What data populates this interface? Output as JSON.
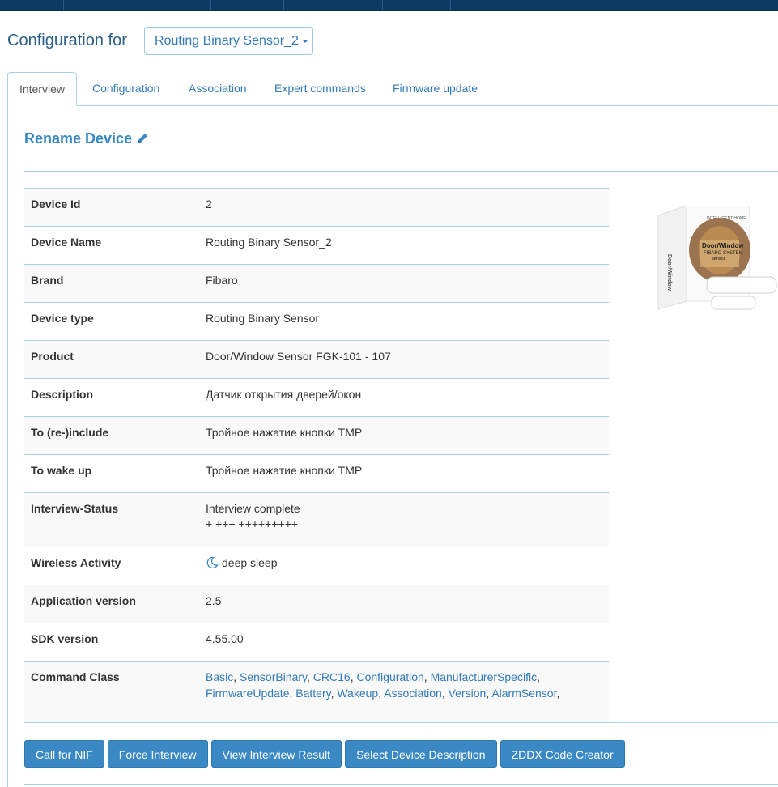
{
  "header": {
    "title": "Configuration for",
    "device_selected": "Routing Binary Sensor_2"
  },
  "tabs": [
    {
      "label": "Interview"
    },
    {
      "label": "Configuration"
    },
    {
      "label": "Association"
    },
    {
      "label": "Expert commands"
    },
    {
      "label": "Firmware update"
    }
  ],
  "rename_label": "Rename Device",
  "rows": [
    {
      "key": "Device Id",
      "value": "2"
    },
    {
      "key": "Device Name",
      "value": "Routing Binary Sensor_2"
    },
    {
      "key": "Brand",
      "value": "Fibaro"
    },
    {
      "key": "Device type",
      "value": "Routing Binary Sensor"
    },
    {
      "key": "Product",
      "value": "Door/Window Sensor FGK-101 - 107"
    },
    {
      "key": "Description",
      "value": "Датчик открытия дверей/окон"
    },
    {
      "key": "To (re-)include",
      "value": "Тройное нажатие кнопки TMP"
    },
    {
      "key": "To wake up",
      "value": "Тройное нажатие кнопки TMP"
    },
    {
      "key": "Interview-Status",
      "value": "Interview complete",
      "value2": "+ +++ +++++++++"
    },
    {
      "key": "Wireless Activity",
      "value": "deep sleep"
    },
    {
      "key": "Application version",
      "value": "2.5"
    },
    {
      "key": "SDK version",
      "value": "4.55.00"
    },
    {
      "key": "Command Class",
      "links_line1": [
        "Basic",
        "SensorBinary",
        "CRC16",
        "Configuration",
        "ManufacturerSpecific"
      ],
      "links_line2": [
        "FirmwareUpdate",
        "Battery",
        "Wakeup",
        "Association",
        "Version",
        "AlarmSensor"
      ]
    }
  ],
  "product_box": {
    "line1": "INTELLIGENT HOME",
    "line2": "Door/Window",
    "line3": "FIBARO SYSTEM",
    "line4": "sensor",
    "side": "Door/Window"
  },
  "buttons": [
    {
      "label": "Call for NIF"
    },
    {
      "label": "Force Interview"
    },
    {
      "label": "View Interview Result"
    },
    {
      "label": "Select Device Description"
    },
    {
      "label": "ZDDX Code Creator"
    }
  ],
  "colors": {
    "accent": "#3a89c4",
    "topbar": "#0d3a63",
    "border": "#a7d2e8"
  }
}
